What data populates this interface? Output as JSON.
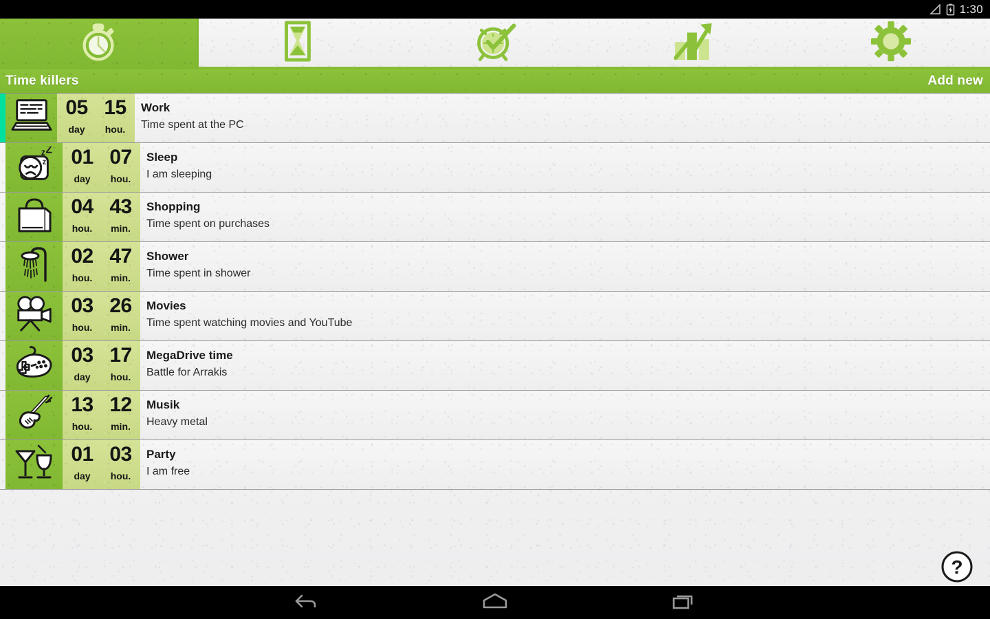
{
  "status_bar": {
    "clock": "1:30",
    "icons": [
      "signal-triangle-icon",
      "battery-charging-icon"
    ]
  },
  "tab_bar": {
    "tabs": [
      {
        "name": "stopwatch",
        "icon": "stopwatch-icon",
        "active": true
      },
      {
        "name": "hourglass",
        "icon": "hourglass-icon",
        "active": false
      },
      {
        "name": "alarm",
        "icon": "alarm-clock-check-icon",
        "active": false
      },
      {
        "name": "statistics",
        "icon": "bar-chart-arrow-icon",
        "active": false
      },
      {
        "name": "settings",
        "icon": "gear-icon",
        "active": false
      }
    ]
  },
  "title_bar": {
    "title": "Time killers",
    "add_new_label": "Add new"
  },
  "colors": {
    "green": "#85bd35",
    "light_green": "#cede8c",
    "accent_active": "#00e0a0",
    "paper": "#f2f2f2",
    "black": "#000000"
  },
  "tasks": [
    {
      "icon": "laptop-icon",
      "name": "Work",
      "description": "Time spent at the PC",
      "value1": "05",
      "unit1": "day",
      "value2": "15",
      "unit2": "hou.",
      "active": true
    },
    {
      "icon": "sleeping-face-icon",
      "name": "Sleep",
      "description": "I am sleeping",
      "value1": "01",
      "unit1": "day",
      "value2": "07",
      "unit2": "hou.",
      "active": false
    },
    {
      "icon": "shopping-bag-icon",
      "name": "Shopping",
      "description": "Time spent on purchases",
      "value1": "04",
      "unit1": "hou.",
      "value2": "43",
      "unit2": "min.",
      "active": false
    },
    {
      "icon": "shower-icon",
      "name": "Shower",
      "description": "Time spent in shower",
      "value1": "02",
      "unit1": "hou.",
      "value2": "47",
      "unit2": "min.",
      "active": false
    },
    {
      "icon": "movie-camera-icon",
      "name": "Movies",
      "description": "Time spent watching movies and YouTube",
      "value1": "03",
      "unit1": "hou.",
      "value2": "26",
      "unit2": "min.",
      "active": false
    },
    {
      "icon": "gamepad-icon",
      "name": "MegaDrive time",
      "description": "Battle for Arrakis",
      "value1": "03",
      "unit1": "day",
      "value2": "17",
      "unit2": "hou.",
      "active": false
    },
    {
      "icon": "guitar-icon",
      "name": "Musik",
      "description": "Heavy metal",
      "value1": "13",
      "unit1": "hou.",
      "value2": "12",
      "unit2": "min.",
      "active": false
    },
    {
      "icon": "cocktail-glasses-icon",
      "name": "Party",
      "description": "I am free",
      "value1": "01",
      "unit1": "day",
      "value2": "03",
      "unit2": "hou.",
      "active": false
    }
  ],
  "help_button": {
    "icon": "question-mark-icon",
    "label": "?"
  },
  "nav_bar": {
    "buttons": [
      {
        "name": "back",
        "icon": "back-arrow-icon"
      },
      {
        "name": "home",
        "icon": "home-icon"
      },
      {
        "name": "recents",
        "icon": "recent-apps-icon"
      }
    ]
  }
}
